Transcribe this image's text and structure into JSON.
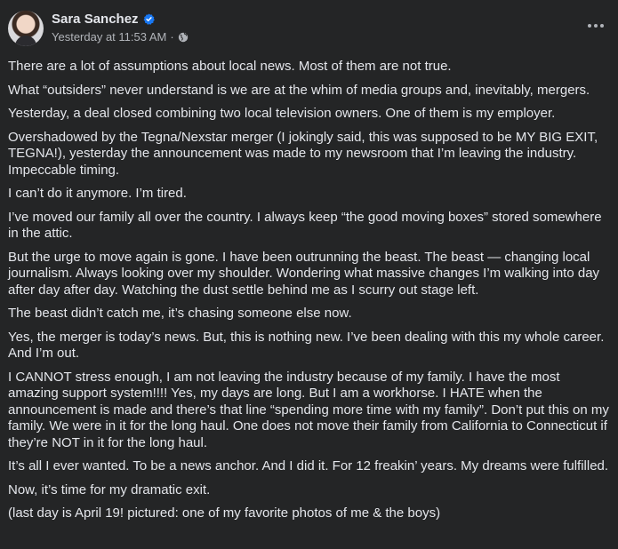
{
  "post": {
    "author": "Sara Sanchez",
    "timestamp": "Yesterday at 11:53 AM",
    "separator": "·",
    "audience_icon": "globe-icon",
    "verified_icon": "verified-badge-icon",
    "more_icon": "more-options-icon",
    "paragraphs": [
      "There are a lot of assumptions about local news. Most of them are not true.",
      "What “outsiders” never understand is we are at the whim of media groups and, inevitably, mergers.",
      "Yesterday, a deal closed combining two local television owners. One of them is my employer.",
      "Overshadowed by the Tegna/Nexstar merger (I jokingly said, this was supposed to be MY BIG EXIT, TEGNA!), yesterday the announcement was made to my newsroom that I’m leaving the industry. Impeccable timing.",
      "I can’t do it anymore. I’m tired.",
      "I’ve moved our family all over the country. I always keep “the good moving boxes” stored somewhere in the attic.",
      "But the urge to move again is gone. I have been outrunning the beast. The beast — changing local journalism. Always looking over my shoulder. Wondering what massive changes I’m walking into day after day after day. Watching the dust settle behind me as I scurry out stage left.",
      "The beast didn’t catch me, it’s chasing someone else now.",
      "Yes, the merger is today’s news. But, this is nothing new. I’ve been dealing with this my whole career. And I’m out.",
      "I CANNOT stress enough, I am not leaving the industry because of my family. I have the most amazing support system!!!! Yes, my days are long. But I am a workhorse. I HATE when the announcement is made and there’s that line “spending more time with my family”. Don’t put this on my family. We were in it for the long haul. One does not move their family from California to Connecticut if they’re NOT in it for the long haul.",
      "It’s all I ever wanted. To be a news anchor. And I did it. For 12 freakin’ years. My dreams were fulfilled.",
      "Now, it’s time for my dramatic exit.",
      "(last day is April 19! pictured: one of my favorite photos of me & the boys)"
    ]
  },
  "colors": {
    "background": "#242526",
    "text_primary": "#e4e6eb",
    "text_secondary": "#b0b3b8",
    "verified_badge": "#1877f2"
  }
}
